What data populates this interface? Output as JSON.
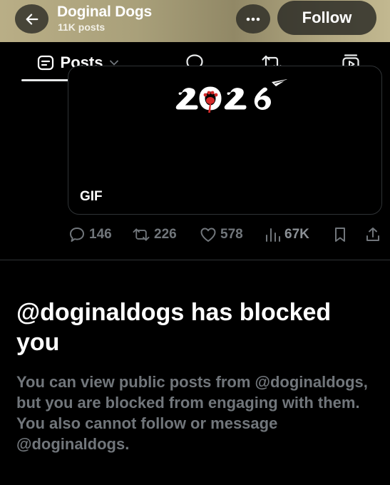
{
  "header": {
    "title": "Doginal Dogs",
    "post_count": "11K posts",
    "follow_label": "Follow"
  },
  "tabs": {
    "posts_label": "Posts"
  },
  "media": {
    "badge": "GIF"
  },
  "actions": {
    "replies": "146",
    "reposts": "226",
    "likes": "578",
    "views": "67K"
  },
  "blocked": {
    "title": "@doginaldogs has blocked you",
    "message": "You can view public posts from @doginaldogs, but you are blocked from engaging with them. You also cannot follow or message @doginaldogs."
  },
  "colors": {
    "header_gradient": "#a9a07a",
    "muted_text": "#71767b",
    "paw_red": "#d42a2a"
  }
}
